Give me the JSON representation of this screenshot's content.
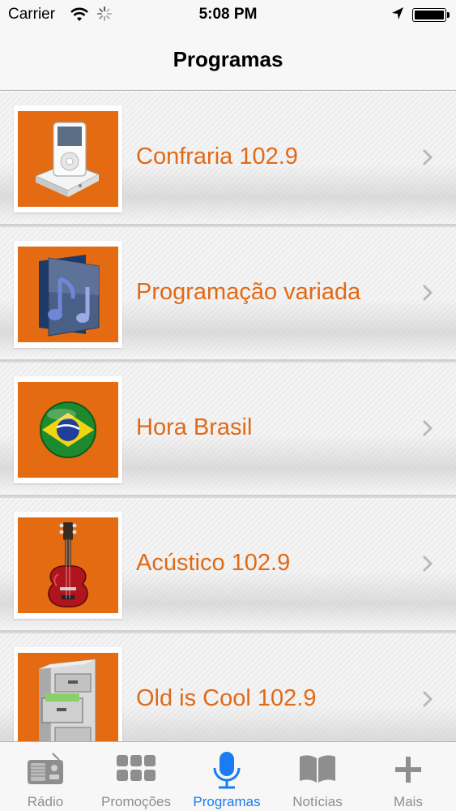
{
  "status_bar": {
    "carrier": "Carrier",
    "time": "5:08 PM"
  },
  "nav": {
    "title": "Programas"
  },
  "programs": [
    {
      "label": "Confraria 102.9",
      "icon": "ipod-dock-icon"
    },
    {
      "label": "Programação variada",
      "icon": "music-folder-icon"
    },
    {
      "label": "Hora Brasil",
      "icon": "brazil-flag-icon"
    },
    {
      "label": "Acústico 102.9",
      "icon": "guitar-icon"
    },
    {
      "label": "Old is Cool 102.9",
      "icon": "file-cabinet-icon"
    }
  ],
  "tabs": [
    {
      "label": "Rádio",
      "icon": "radio-icon",
      "active": false
    },
    {
      "label": "Promoções",
      "icon": "grid-icon",
      "active": false
    },
    {
      "label": "Programas",
      "icon": "microphone-icon",
      "active": true
    },
    {
      "label": "Notícias",
      "icon": "book-icon",
      "active": false
    },
    {
      "label": "Mais",
      "icon": "plus-icon",
      "active": false
    }
  ],
  "colors": {
    "accent_orange": "#e56b12",
    "label_orange": "#e06a18",
    "tab_active": "#1a7cf0",
    "tab_inactive": "#8e8e8e"
  }
}
